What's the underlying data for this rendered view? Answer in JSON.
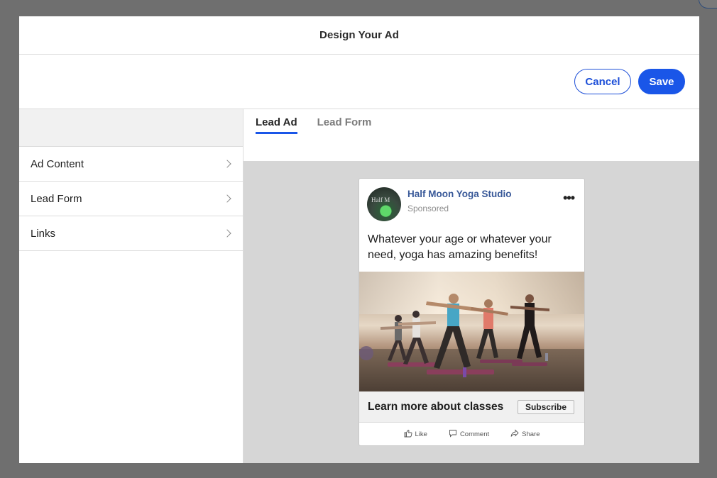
{
  "modal": {
    "title": "Design Your Ad",
    "cancel_label": "Cancel",
    "save_label": "Save"
  },
  "sidebar": {
    "items": [
      {
        "label": "Ad Content"
      },
      {
        "label": "Lead Form"
      },
      {
        "label": "Links"
      }
    ]
  },
  "tabs": [
    {
      "label": "Lead Ad",
      "active": true
    },
    {
      "label": "Lead Form",
      "active": false
    }
  ],
  "ad_preview": {
    "page_name": "Half Moon Yoga Studio",
    "sponsored": "Sponsored",
    "avatar_text": "Half M",
    "more_icon": "more-dots-icon",
    "body_text": "Whatever your age or whatever your need, yoga has amazing benefits!",
    "cta_text": "Learn more about classes",
    "cta_button": "Subscribe",
    "actions": [
      {
        "label": "Like",
        "icon": "thumbs-up-icon"
      },
      {
        "label": "Comment",
        "icon": "comment-icon"
      },
      {
        "label": "Share",
        "icon": "share-icon"
      }
    ]
  },
  "colors": {
    "accent": "#1a56e8",
    "page_name": "#385898",
    "preview_bg": "#d6d6d6"
  }
}
